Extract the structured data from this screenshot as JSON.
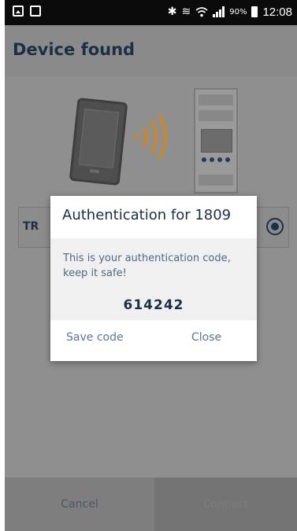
{
  "status_bar": {
    "battery_percent": "90%",
    "time": "12:08",
    "icons": [
      "image-icon",
      "cast-icon",
      "bluetooth-icon",
      "vibrate-icon",
      "wifi-icon",
      "signal-icon",
      "battery-icon"
    ]
  },
  "header": {
    "title": "Device found"
  },
  "device_list": {
    "items": [
      {
        "name": "TR",
        "selected": true
      }
    ]
  },
  "dialog": {
    "title": "Authentication for 1809",
    "message": "This is your authentication code, keep it safe!",
    "code": "614242",
    "save_label": "Save code",
    "close_label": "Close"
  },
  "footer": {
    "cancel_label": "Cancel",
    "connect_label": "Connect"
  },
  "colors": {
    "primary": "#1b2f45",
    "accent_wave": "#c9872a",
    "dialog_link": "#5a7795",
    "overlay": "#8f8f8f"
  }
}
